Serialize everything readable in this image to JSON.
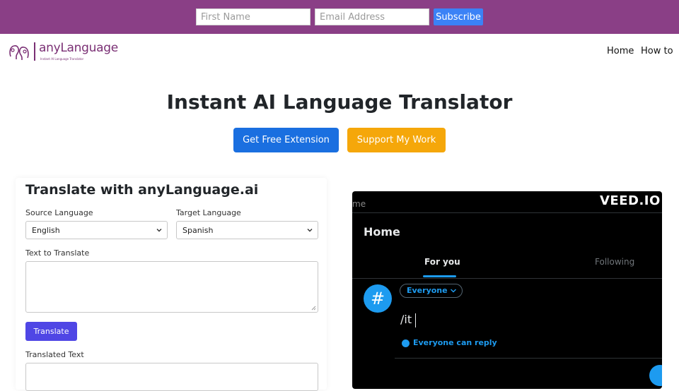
{
  "subscribe": {
    "first_name_placeholder": "First Name",
    "email_placeholder": "Email Address",
    "button_label": "Subscribe",
    "bar_color": "#8a3f86"
  },
  "nav": {
    "logo_text": "anyLanguage",
    "logo_tagline": "Instant AI Language Translator",
    "links": [
      "Home",
      "How to"
    ]
  },
  "hero": {
    "title": "Instant AI Language Translator",
    "extension_button": "Get Free Extension",
    "support_button": "Support My Work"
  },
  "translator": {
    "title": "Translate with anyLanguage.ai",
    "source_label": "Source Language",
    "source_value": "English",
    "target_label": "Target Language",
    "target_value": "Spanish",
    "text_label": "Text to Translate",
    "text_value": "",
    "translate_button": "Translate",
    "output_label": "Translated Text",
    "output_value": ""
  },
  "video": {
    "watermark": "VEED.IO",
    "cropped_header": "me",
    "home_title": "Home",
    "tabs": [
      "For you",
      "Following"
    ],
    "avatar_glyph": "#",
    "audience": "Everyone",
    "compose_text": "/it",
    "reply_setting": "Everyone can reply",
    "accent_color": "#1d9bf0"
  }
}
